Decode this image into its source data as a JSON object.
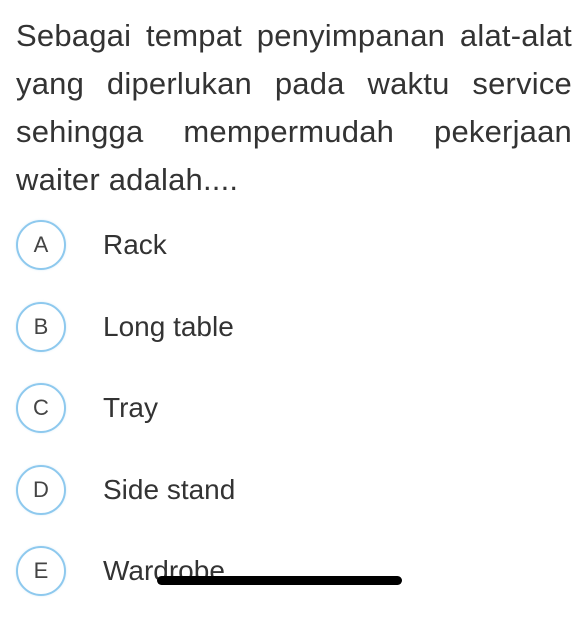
{
  "question": {
    "text": "Sebagai tempat penyimpanan alat-alat yang diperlukan pada waktu service sehingga mempermudah pekerjaan waiter adalah...."
  },
  "options": [
    {
      "letter": "A",
      "label": "Rack"
    },
    {
      "letter": "B",
      "label": "Long table"
    },
    {
      "letter": "C",
      "label": "Tray"
    },
    {
      "letter": "D",
      "label": "Side stand"
    },
    {
      "letter": "E",
      "label": "Wardrobe"
    }
  ],
  "colors": {
    "circle_border": "#8ec9ee",
    "text": "#333333"
  }
}
